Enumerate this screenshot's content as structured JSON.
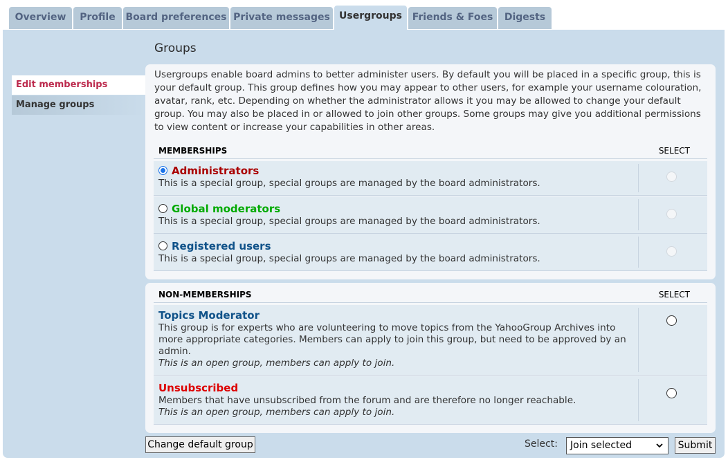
{
  "tabs": [
    {
      "label": "Overview"
    },
    {
      "label": "Profile"
    },
    {
      "label": "Board preferences"
    },
    {
      "label": "Private messages"
    },
    {
      "label": "Usergroups",
      "active": true
    },
    {
      "label": "Friends & Foes"
    },
    {
      "label": "Digests"
    }
  ],
  "heading": "Groups",
  "menu": [
    {
      "label": "Edit memberships"
    },
    {
      "label": "Manage groups"
    }
  ],
  "intro": "Usergroups enable board admins to better administer users. By default you will be placed in a specific group, this is your default group. This group defines how you may appear to other users, for example your username colouration, avatar, rank, etc. Depending on whether the administrator allows it you may be allowed to change your default group. You may also be placed in or allowed to join other groups. Some groups may give you additional permissions to view content or increase your capabilities in other areas.",
  "memberships": {
    "header": "MEMBERSHIPS",
    "select_header": "SELECT",
    "groups": [
      {
        "name": "Administrators",
        "color": "#aa0000",
        "desc": "This is a special group, special groups are managed by the board administrators.",
        "default": true
      },
      {
        "name": "Global moderators",
        "color": "#00aa00",
        "desc": "This is a special group, special groups are managed by the board administrators.",
        "default": false
      },
      {
        "name": "Registered users",
        "color": "#105289",
        "desc": "This is a special group, special groups are managed by the board administrators.",
        "default": false
      }
    ]
  },
  "non_memberships": {
    "header": "NON-MEMBERSHIPS",
    "select_header": "SELECT",
    "groups": [
      {
        "name": "Topics Moderator",
        "color": "#105289",
        "desc": "This group is for experts who are volunteering to move topics from the YahooGroup Archives into more appropriate categories. Members can apply to join this group, but need to be approved by an admin.",
        "note": "This is an open group, members can apply to join."
      },
      {
        "name": "Unsubscribed",
        "color": "#dd0000",
        "desc": "Members that have unsubscribed from the forum and are therefore no longer reachable.",
        "note": "This is an open group, members can apply to join."
      }
    ]
  },
  "footer": {
    "change_default_label": "Change default group",
    "select_label": "Select:",
    "select_value": "Join selected",
    "submit_label": "Submit"
  }
}
